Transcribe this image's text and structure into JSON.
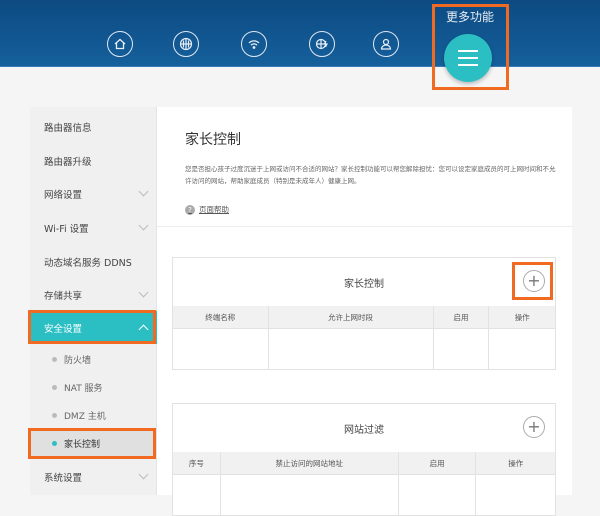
{
  "header": {
    "more_label": "更多功能",
    "icons": [
      "home-icon",
      "globe-icon",
      "wifi-icon",
      "globe-settings-icon",
      "user-icon"
    ],
    "brand_color": "#0f4f86",
    "accent": "#2bbfc4"
  },
  "sidebar": {
    "items": [
      {
        "label": "路由器信息"
      },
      {
        "label": "路由器升级"
      },
      {
        "label": "网络设置"
      },
      {
        "label": "Wi-Fi 设置"
      },
      {
        "label": "动态域名服务 DDNS"
      },
      {
        "label": "存储共享"
      },
      {
        "label": "安全设置"
      },
      {
        "label": "防火墙"
      },
      {
        "label": "NAT 服务"
      },
      {
        "label": "DMZ 主机"
      },
      {
        "label": "家长控制"
      },
      {
        "label": "系统设置"
      }
    ]
  },
  "main": {
    "title": "家长控制",
    "description": "您是否担心孩子过度沉迷于上网或访问不合适的网站？家长控制功能可以帮您解除担忧：您可以设定家庭成员的可上网时间和不允许访问的网站，帮助家庭成员（特别是未成年人）健康上网。",
    "help_link": "页面帮助",
    "parental_card": {
      "title": "家长控制",
      "columns": [
        "终端名称",
        "允许上网时段",
        "启用",
        "操作"
      ]
    },
    "filter_card": {
      "title": "网站过滤",
      "columns": [
        "序号",
        "禁止访问的网站地址",
        "启用",
        "操作"
      ]
    },
    "plus_symbol": "+",
    "help_symbol": "?"
  }
}
